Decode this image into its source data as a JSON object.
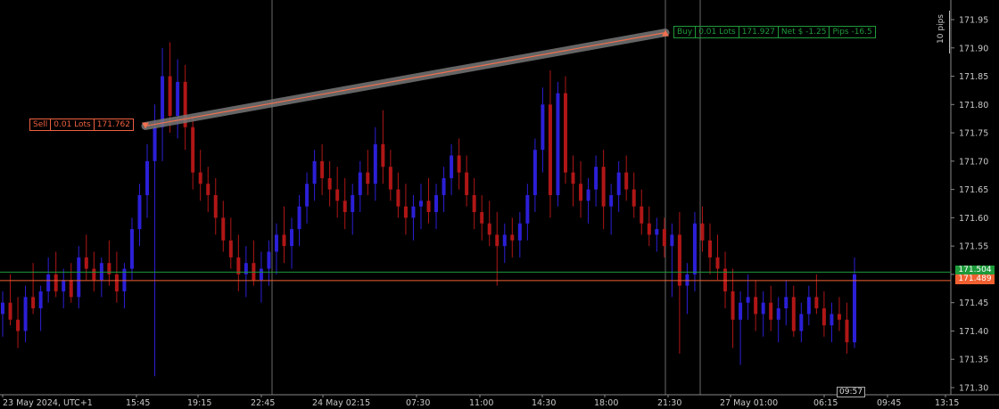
{
  "chart_data": {
    "type": "candlestick",
    "y_ticks": [
      "171.95",
      "171.90",
      "171.85",
      "171.80",
      "171.75",
      "171.70",
      "171.65",
      "171.60",
      "171.55",
      "171.50",
      "171.45",
      "171.40",
      "171.35",
      "171.30"
    ],
    "ylim": [
      171.29,
      171.975
    ],
    "x_ticks": [
      "23 May 2024, UTC+1",
      "15:45",
      "19:15",
      "22:45",
      "24 May 02:15",
      "07:30",
      "11:00",
      "14:30",
      "18:00",
      "21:30",
      "27 May 01:00",
      "06:15",
      "09:45",
      "13:15"
    ],
    "bid_price": "171.504",
    "ask_price": "171.489",
    "bid_value": 171.504,
    "ask_value": 171.489,
    "pips_label": "10 pips",
    "time_cursor": "09:57",
    "colors": {
      "bull": "#2b1fd6",
      "bear": "#b01616",
      "bid_line": "#1d9a3a",
      "ask_line": "#f06030",
      "grid": "#555555",
      "axis_text": "#c8c8c8"
    },
    "trade": {
      "sell": {
        "side": "Sell",
        "lots": "0.01 Lots",
        "price": "171.762",
        "value": 171.762
      },
      "buy": {
        "side": "Buy",
        "lots": "0.01 Lots",
        "price": "171.927",
        "value": 171.927,
        "net": "Net $ -1.25",
        "pips": "Pips -16.5"
      }
    },
    "candles": [
      [
        171.43,
        171.47,
        171.39,
        171.45
      ],
      [
        171.45,
        171.5,
        171.41,
        171.42
      ],
      [
        171.42,
        171.46,
        171.37,
        171.4
      ],
      [
        171.4,
        171.48,
        171.38,
        171.46
      ],
      [
        171.46,
        171.52,
        171.43,
        171.44
      ],
      [
        171.44,
        171.48,
        171.4,
        171.47
      ],
      [
        171.47,
        171.53,
        171.45,
        171.5
      ],
      [
        171.5,
        171.54,
        171.46,
        171.47
      ],
      [
        171.47,
        171.51,
        171.44,
        171.49
      ],
      [
        171.49,
        171.52,
        171.45,
        171.46
      ],
      [
        171.46,
        171.55,
        171.44,
        171.53
      ],
      [
        171.53,
        171.57,
        171.49,
        171.51
      ],
      [
        171.51,
        171.54,
        171.47,
        171.49
      ],
      [
        171.49,
        171.53,
        171.46,
        171.52
      ],
      [
        171.52,
        171.56,
        171.48,
        171.5
      ],
      [
        171.5,
        171.54,
        171.45,
        171.47
      ],
      [
        171.47,
        171.52,
        171.44,
        171.51
      ],
      [
        171.51,
        171.6,
        171.49,
        171.58
      ],
      [
        171.58,
        171.66,
        171.55,
        171.64
      ],
      [
        171.64,
        171.73,
        171.6,
        171.7
      ],
      [
        171.7,
        171.8,
        171.32,
        171.76
      ],
      [
        171.76,
        171.9,
        171.7,
        171.85
      ],
      [
        171.85,
        171.91,
        171.75,
        171.78
      ],
      [
        171.78,
        171.88,
        171.74,
        171.84
      ],
      [
        171.84,
        171.87,
        171.72,
        171.76
      ],
      [
        171.76,
        171.78,
        171.65,
        171.68
      ],
      [
        171.68,
        171.72,
        171.63,
        171.66
      ],
      [
        171.66,
        171.69,
        171.61,
        171.64
      ],
      [
        171.64,
        171.67,
        171.57,
        171.6
      ],
      [
        171.6,
        171.63,
        171.54,
        171.56
      ],
      [
        171.56,
        171.6,
        171.51,
        171.53
      ],
      [
        171.53,
        171.57,
        171.47,
        171.5
      ],
      [
        171.5,
        171.55,
        171.46,
        171.52
      ],
      [
        171.52,
        171.56,
        171.48,
        171.49
      ],
      [
        171.49,
        171.54,
        171.45,
        171.51
      ],
      [
        171.51,
        171.56,
        171.48,
        171.54
      ],
      [
        171.54,
        171.59,
        171.5,
        171.57
      ],
      [
        171.57,
        171.62,
        171.52,
        171.55
      ],
      [
        171.55,
        171.6,
        171.51,
        171.58
      ],
      [
        171.58,
        171.64,
        171.55,
        171.62
      ],
      [
        171.62,
        171.68,
        171.59,
        171.66
      ],
      [
        171.66,
        171.72,
        171.63,
        171.7
      ],
      [
        171.7,
        171.73,
        171.64,
        171.67
      ],
      [
        171.67,
        171.7,
        171.62,
        171.65
      ],
      [
        171.65,
        171.69,
        171.6,
        171.63
      ],
      [
        171.63,
        171.67,
        171.58,
        171.61
      ],
      [
        171.61,
        171.66,
        171.57,
        171.64
      ],
      [
        171.64,
        171.7,
        171.61,
        171.68
      ],
      [
        171.68,
        171.72,
        171.64,
        171.66
      ],
      [
        171.66,
        171.76,
        171.63,
        171.73
      ],
      [
        171.73,
        171.79,
        171.66,
        171.69
      ],
      [
        171.69,
        171.72,
        171.63,
        171.65
      ],
      [
        171.65,
        171.68,
        171.6,
        171.62
      ],
      [
        171.62,
        171.66,
        171.57,
        171.6
      ],
      [
        171.6,
        171.64,
        171.56,
        171.62
      ],
      [
        171.62,
        171.66,
        171.58,
        171.63
      ],
      [
        171.63,
        171.67,
        171.59,
        171.61
      ],
      [
        171.61,
        171.66,
        171.58,
        171.64
      ],
      [
        171.64,
        171.69,
        171.61,
        171.67
      ],
      [
        171.67,
        171.73,
        171.64,
        171.71
      ],
      [
        171.71,
        171.74,
        171.65,
        171.68
      ],
      [
        171.68,
        171.71,
        171.62,
        171.64
      ],
      [
        171.64,
        171.67,
        171.58,
        171.61
      ],
      [
        171.61,
        171.64,
        171.56,
        171.59
      ],
      [
        171.59,
        171.63,
        171.55,
        171.57
      ],
      [
        171.57,
        171.61,
        171.48,
        171.55
      ],
      [
        171.55,
        171.59,
        171.52,
        171.57
      ],
      [
        171.57,
        171.6,
        171.53,
        171.56
      ],
      [
        171.56,
        171.61,
        171.53,
        171.59
      ],
      [
        171.59,
        171.66,
        171.56,
        171.64
      ],
      [
        171.64,
        171.74,
        171.61,
        171.72
      ],
      [
        171.72,
        171.83,
        171.68,
        171.8
      ],
      [
        171.8,
        171.86,
        171.6,
        171.64
      ],
      [
        171.64,
        171.84,
        171.62,
        171.82
      ],
      [
        171.82,
        171.85,
        171.66,
        171.68
      ],
      [
        171.68,
        171.71,
        171.62,
        171.66
      ],
      [
        171.66,
        171.7,
        171.6,
        171.63
      ],
      [
        171.63,
        171.67,
        171.59,
        171.65
      ],
      [
        171.65,
        171.71,
        171.62,
        171.69
      ],
      [
        171.69,
        171.72,
        171.58,
        171.62
      ],
      [
        171.62,
        171.66,
        171.57,
        171.64
      ],
      [
        171.64,
        171.7,
        171.61,
        171.68
      ],
      [
        171.68,
        171.71,
        171.63,
        171.65
      ],
      [
        171.65,
        171.68,
        171.6,
        171.62
      ],
      [
        171.62,
        171.65,
        171.57,
        171.59
      ],
      [
        171.59,
        171.62,
        171.55,
        171.57
      ],
      [
        171.57,
        171.6,
        171.54,
        171.58
      ],
      [
        171.58,
        171.6,
        171.53,
        171.55
      ],
      [
        171.55,
        171.59,
        171.46,
        171.57
      ],
      [
        171.57,
        171.61,
        171.36,
        171.48
      ],
      [
        171.48,
        171.52,
        171.43,
        171.5
      ],
      [
        171.5,
        171.61,
        171.47,
        171.59
      ],
      [
        171.59,
        171.62,
        171.54,
        171.56
      ],
      [
        171.56,
        171.59,
        171.5,
        171.53
      ],
      [
        171.53,
        171.57,
        171.49,
        171.51
      ],
      [
        171.51,
        171.54,
        171.44,
        171.47
      ],
      [
        171.47,
        171.51,
        171.37,
        171.42
      ],
      [
        171.42,
        171.47,
        171.34,
        171.45
      ],
      [
        171.45,
        171.5,
        171.42,
        171.46
      ],
      [
        171.46,
        171.49,
        171.4,
        171.43
      ],
      [
        171.43,
        171.47,
        171.39,
        171.45
      ],
      [
        171.45,
        171.48,
        171.4,
        171.42
      ],
      [
        171.42,
        171.46,
        171.38,
        171.44
      ],
      [
        171.44,
        171.49,
        171.41,
        171.46
      ],
      [
        171.46,
        171.48,
        171.39,
        171.4
      ],
      [
        171.4,
        171.45,
        171.38,
        171.43
      ],
      [
        171.43,
        171.48,
        171.41,
        171.46
      ],
      [
        171.46,
        171.5,
        171.43,
        171.44
      ],
      [
        171.44,
        171.47,
        171.39,
        171.41
      ],
      [
        171.41,
        171.45,
        171.38,
        171.43
      ],
      [
        171.43,
        171.46,
        171.4,
        171.42
      ],
      [
        171.42,
        171.45,
        171.36,
        171.38
      ],
      [
        171.38,
        171.53,
        171.37,
        171.5
      ]
    ]
  }
}
